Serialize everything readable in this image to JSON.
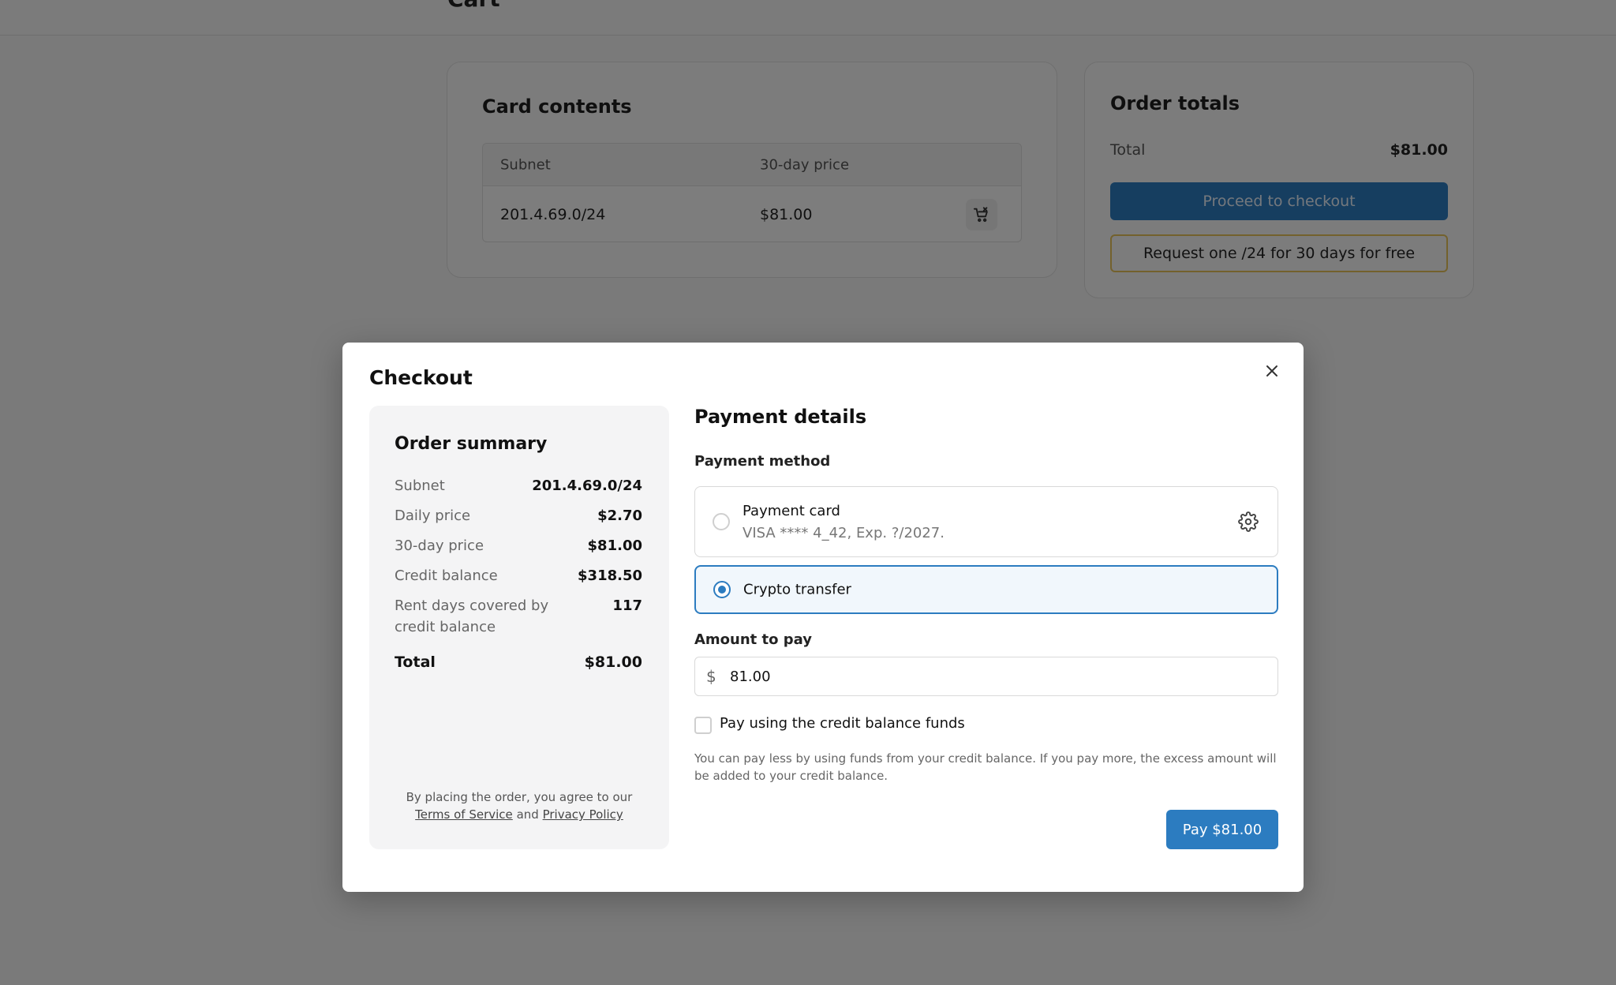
{
  "background": {
    "header_title": "Cart",
    "cart_panel": {
      "title": "Card contents",
      "columns": [
        "Subnet",
        "30-day price"
      ],
      "rows": [
        {
          "subnet": "201.4.69.0/24",
          "price": "$81.00"
        }
      ]
    },
    "totals_panel": {
      "title": "Order totals",
      "total_label": "Total",
      "total_value": "$81.00",
      "checkout_label": "Proceed to checkout",
      "request_label": "Request one /24 for 30 days for free"
    }
  },
  "modal": {
    "title": "Checkout",
    "summary": {
      "title": "Order summary",
      "rows": [
        {
          "label": "Subnet",
          "value": "201.4.69.0/24"
        },
        {
          "label": "Daily price",
          "value": "$2.70"
        },
        {
          "label": "30-day price",
          "value": "$81.00"
        },
        {
          "label": "Credit balance",
          "value": "$318.50"
        },
        {
          "label": "Rent days covered by credit balance",
          "value": "117"
        }
      ],
      "total_label": "Total",
      "total_value": "$81.00",
      "terms_prefix": "By placing the order, you agree to our",
      "terms_link": "Terms of Service",
      "terms_and": "and",
      "privacy_link": "Privacy Policy"
    },
    "payment": {
      "title": "Payment details",
      "method_label": "Payment method",
      "methods": [
        {
          "name": "Payment card",
          "detail": "VISA **** 4_42, Exp. ?/2027.",
          "selected": false
        },
        {
          "name": "Crypto transfer",
          "selected": true
        }
      ],
      "amount_label": "Amount to pay",
      "currency_symbol": "$",
      "amount_value": "81.00",
      "credit_checkbox_label": "Pay using the credit balance funds",
      "credit_checkbox_checked": false,
      "hint": "You can pay less by using funds from your credit balance. If you pay more, the excess amount will be added to your credit balance.",
      "pay_button_label": "Pay $81.00"
    }
  },
  "colors": {
    "accent": "#2c7cc0",
    "request_border": "#e7c35a",
    "overlay": "rgba(0,0,0,0.5)"
  },
  "icons": {
    "close": "close-icon",
    "gear": "gear-icon",
    "cart_remove": "cart-remove-icon",
    "dollar": "dollar-icon"
  }
}
